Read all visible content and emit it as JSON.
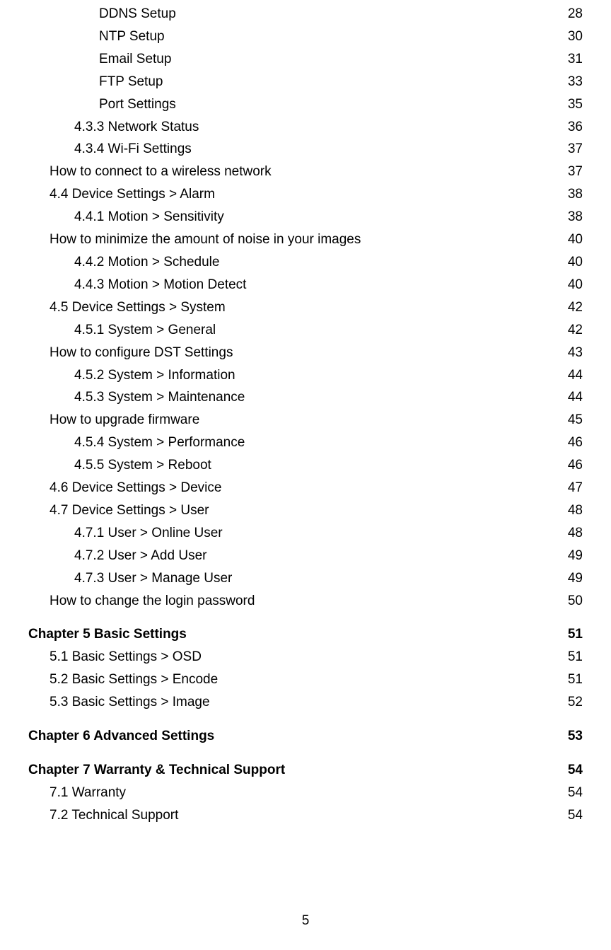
{
  "toc": [
    {
      "label": "DDNS Setup",
      "page": "28",
      "indent": 3,
      "chapter": false
    },
    {
      "label": "NTP Setup",
      "page": "30",
      "indent": 3,
      "chapter": false
    },
    {
      "label": "Email Setup",
      "page": "31",
      "indent": 3,
      "chapter": false
    },
    {
      "label": "FTP Setup",
      "page": "33",
      "indent": 3,
      "chapter": false
    },
    {
      "label": "Port Settings",
      "page": "35",
      "indent": 3,
      "chapter": false
    },
    {
      "label": "4.3.3 Network Status",
      "page": "36",
      "indent": 2,
      "chapter": false
    },
    {
      "label": "4.3.4 Wi-Fi Settings",
      "page": "37",
      "indent": 2,
      "chapter": false
    },
    {
      "label": "How to connect to a wireless network",
      "page": "37",
      "indent": 1,
      "chapter": false
    },
    {
      "label": "4.4 Device Settings > Alarm",
      "page": "38",
      "indent": 1,
      "chapter": false
    },
    {
      "label": "4.4.1 Motion > Sensitivity",
      "page": "38",
      "indent": 2,
      "chapter": false
    },
    {
      "label": "How to minimize the amount of noise in your images",
      "page": "40",
      "indent": 1,
      "chapter": false
    },
    {
      "label": "4.4.2 Motion > Schedule",
      "page": "40",
      "indent": 2,
      "chapter": false
    },
    {
      "label": "4.4.3 Motion > Motion Detect",
      "page": "40",
      "indent": 2,
      "chapter": false
    },
    {
      "label": "4.5 Device Settings > System",
      "page": "42",
      "indent": 1,
      "chapter": false
    },
    {
      "label": "4.5.1 System > General",
      "page": "42",
      "indent": 2,
      "chapter": false
    },
    {
      "label": "How to configure DST Settings",
      "page": "43",
      "indent": 1,
      "chapter": false
    },
    {
      "label": "4.5.2 System > Information",
      "page": "44",
      "indent": 2,
      "chapter": false
    },
    {
      "label": "4.5.3 System > Maintenance",
      "page": "44",
      "indent": 2,
      "chapter": false
    },
    {
      "label": "How to upgrade firmware",
      "page": "45",
      "indent": 1,
      "chapter": false
    },
    {
      "label": "4.5.4 System > Performance",
      "page": "46",
      "indent": 2,
      "chapter": false
    },
    {
      "label": "4.5.5 System > Reboot",
      "page": "46",
      "indent": 2,
      "chapter": false
    },
    {
      "label": "4.6 Device Settings > Device",
      "page": "47",
      "indent": 1,
      "chapter": false
    },
    {
      "label": "4.7 Device Settings > User",
      "page": "48",
      "indent": 1,
      "chapter": false
    },
    {
      "label": "4.7.1 User > Online User",
      "page": "48",
      "indent": 2,
      "chapter": false
    },
    {
      "label": "4.7.2 User > Add User",
      "page": "49",
      "indent": 2,
      "chapter": false
    },
    {
      "label": "4.7.3 User > Manage User",
      "page": "49",
      "indent": 2,
      "chapter": false
    },
    {
      "label": "How to change the login password",
      "page": "50",
      "indent": 1,
      "chapter": false
    },
    {
      "label": "Chapter 5 Basic Settings",
      "page": "51",
      "indent": 0,
      "chapter": true
    },
    {
      "label": "5.1 Basic Settings > OSD",
      "page": "51",
      "indent": 1,
      "chapter": false
    },
    {
      "label": "5.2 Basic Settings > Encode",
      "page": "51",
      "indent": 1,
      "chapter": false
    },
    {
      "label": "5.3 Basic Settings > Image",
      "page": "52",
      "indent": 1,
      "chapter": false
    },
    {
      "label": "Chapter 6 Advanced Settings",
      "page": "53",
      "indent": 0,
      "chapter": true
    },
    {
      "label": "Chapter 7 Warranty & Technical Support",
      "page": "54",
      "indent": 0,
      "chapter": true
    },
    {
      "label": "7.1 Warranty",
      "page": "54",
      "indent": 1,
      "chapter": false
    },
    {
      "label": "7.2 Technical Support",
      "page": "54",
      "indent": 1,
      "chapter": false
    }
  ],
  "pageNumber": "5"
}
